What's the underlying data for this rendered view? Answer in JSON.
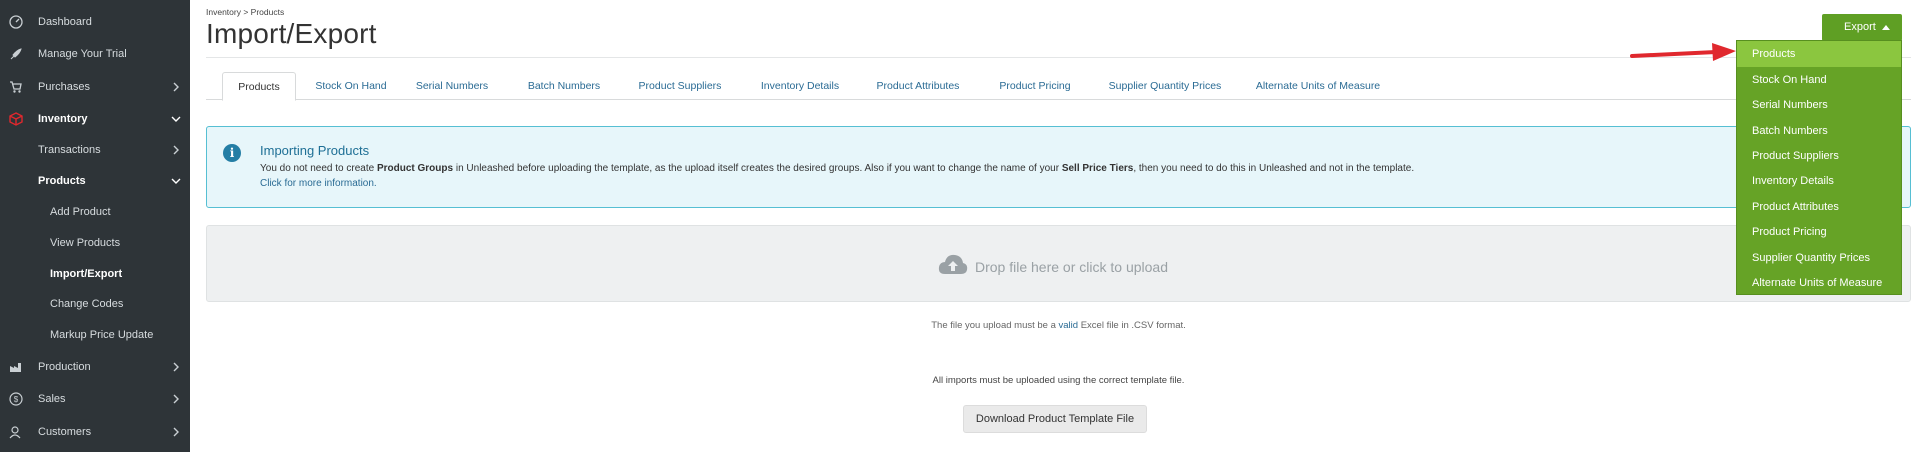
{
  "sidebar": {
    "items": [
      {
        "label": "Dashboard",
        "icon": "dashboard-icon"
      },
      {
        "label": "Manage Your Trial",
        "icon": "rocket-icon"
      },
      {
        "label": "Purchases",
        "icon": "cart-icon"
      },
      {
        "label": "Inventory",
        "icon": "box-icon"
      },
      {
        "label": "Transactions"
      },
      {
        "label": "Products"
      },
      {
        "label": "Add Product"
      },
      {
        "label": "View Products"
      },
      {
        "label": "Import/Export"
      },
      {
        "label": "Change Codes"
      },
      {
        "label": "Markup Price Update"
      },
      {
        "label": "Production",
        "icon": "factory-icon"
      },
      {
        "label": "Sales",
        "icon": "dollar-icon"
      },
      {
        "label": "Customers",
        "icon": "customers-icon"
      }
    ]
  },
  "breadcrumb": "Inventory > Products",
  "page_title": "Import/Export",
  "tabs": [
    "Products",
    "Stock On Hand",
    "Serial Numbers",
    "Batch Numbers",
    "Product Suppliers",
    "Inventory Details",
    "Product Attributes",
    "Product Pricing",
    "Supplier Quantity Prices",
    "Alternate Units of Measure"
  ],
  "info": {
    "title": "Importing Products",
    "body_1": "You do not need to create ",
    "body_b1": "Product Groups",
    "body_2": " in Unleashed before uploading the template, as the upload itself creates the desired groups. Also if you want to change the name of your ",
    "body_b2": "Sell Price Tiers",
    "body_3": ", then you need to do this in Unleashed and not in the template.",
    "link": "Click for more information."
  },
  "dropzone": {
    "text": "Drop file here or click to upload"
  },
  "note": {
    "pre": "The file you upload must be a ",
    "valid": "valid",
    "post": " Excel file in .CSV format."
  },
  "note2": "All imports must be uploaded using the correct template file.",
  "download_button": "Download Product Template File",
  "export": {
    "label": "Export",
    "menu": [
      "Products",
      "Stock On Hand",
      "Serial Numbers",
      "Batch Numbers",
      "Product Suppliers",
      "Inventory Details",
      "Product Attributes",
      "Product Pricing",
      "Supplier Quantity Prices",
      "Alternate Units of Measure"
    ]
  },
  "colors": {
    "accent_green": "#5f9f24",
    "menu_hover": "#8bc63f",
    "link_blue": "#2a6b94",
    "sidebar_bg": "#2e3438",
    "arrow_red": "#e0282e"
  }
}
